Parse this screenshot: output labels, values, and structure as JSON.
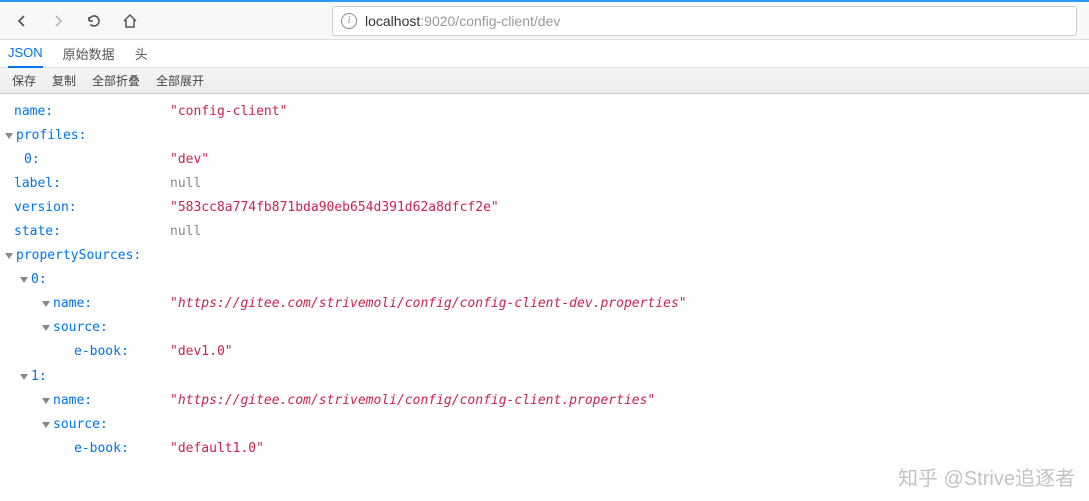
{
  "url": {
    "host": "localhost",
    "port_path": ":9020/config-client/dev"
  },
  "tabs": {
    "json": "JSON",
    "raw": "原始数据",
    "headers": "头"
  },
  "actions": {
    "save": "保存",
    "copy": "复制",
    "collapse_all": "全部折叠",
    "expand_all": "全部展开"
  },
  "json_data": {
    "name_key": "name:",
    "name_val": "\"config-client\"",
    "profiles_key": "profiles:",
    "profiles_0_key": "0:",
    "profiles_0_val": "\"dev\"",
    "label_key": "label:",
    "label_val": "null",
    "version_key": "version:",
    "version_val": "\"583cc8a774fb871bda90eb654d391d62a8dfcf2e\"",
    "state_key": "state:",
    "state_val": "null",
    "propertySources_key": "propertySources:",
    "ps0_key": "0:",
    "ps0_name_key": "name:",
    "ps0_name_val": "\"https://gitee.com/strivemoli/config/config-client-dev.properties\"",
    "ps0_source_key": "source:",
    "ps0_ebook_key": "e-book:",
    "ps0_ebook_val": "\"dev1.0\"",
    "ps1_key": "1:",
    "ps1_name_key": "name:",
    "ps1_name_val": "\"https://gitee.com/strivemoli/config/config-client.properties\"",
    "ps1_source_key": "source:",
    "ps1_ebook_key": "e-book:",
    "ps1_ebook_val": "\"default1.0\""
  },
  "watermark": "知乎 @Strive追逐者"
}
